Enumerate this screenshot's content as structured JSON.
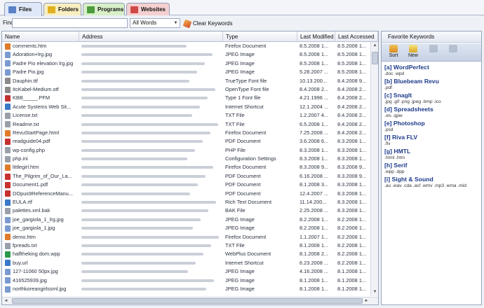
{
  "tabs": [
    {
      "label": "Files",
      "color": "#5b82c6"
    },
    {
      "label": "Folders",
      "color": "#e0b020"
    },
    {
      "label": "Programs",
      "color": "#4c9c3c"
    },
    {
      "label": "Websites",
      "color": "#d04848"
    }
  ],
  "find": {
    "label": "Find:",
    "value": "",
    "mode": "All Words",
    "clear_label": "Clear Keywords"
  },
  "columns": [
    "Name",
    "Address",
    "Type",
    "Last Modified",
    "Last Accessed"
  ],
  "files": [
    {
      "name": "comments.htm",
      "type": "Firefox Document",
      "modified": "8.5.2008 1...",
      "accessed": "8.5.2008 1...",
      "icon_color": "#e07a2a"
    },
    {
      "name": "Adoration+lrg.jpg",
      "type": "JPEG Image",
      "modified": "8.5.2008 1...",
      "accessed": "8.5.2008 1...",
      "icon_color": "#7a9ad0"
    },
    {
      "name": "Padre Pio elevation lrg.jpg",
      "type": "JPEG Image",
      "modified": "8.5.2008 1...",
      "accessed": "8.5.2008 1...",
      "icon_color": "#7a9ad0"
    },
    {
      "name": "Padre Pio.jpg",
      "type": "JPEG Image",
      "modified": "5.28.2007 ...",
      "accessed": "8.5.2008 1...",
      "icon_color": "#7a9ad0"
    },
    {
      "name": "Dauphin.ttf",
      "type": "TrueType Font file",
      "modified": "10.13.200...",
      "accessed": "8.4.2008 9...",
      "icon_color": "#8a8a8a"
    },
    {
      "name": "ItcKabel-Medium.otf",
      "type": "OpenType Font file",
      "modified": "8.4.2008 2...",
      "accessed": "8.4.2008 2...",
      "icon_color": "#8a8a8a"
    },
    {
      "name": "KBB_____.PFM",
      "type": "Type 1 Font file",
      "modified": "4.21.1996 ...",
      "accessed": "8.4.2008 2...",
      "icon_color": "#c03030"
    },
    {
      "name": "Acute Systems Web Sit...",
      "type": "Internet Shortcut",
      "modified": "12.1.2004 ...",
      "accessed": "8.4.2008 2...",
      "icon_color": "#3a78c8"
    },
    {
      "name": "License.txt",
      "type": "TXT File",
      "modified": "1.2.2007 4...",
      "accessed": "8.4.2008 2...",
      "icon_color": "#9aa0aa"
    },
    {
      "name": "Readme.txt",
      "type": "TXT File",
      "modified": "6.5.2008 1...",
      "accessed": "8.4.2008 2...",
      "icon_color": "#9aa0aa"
    },
    {
      "name": "RevuStartPage.html",
      "type": "Firefox Document",
      "modified": "7.25.2008 ...",
      "accessed": "8.4.2008 2...",
      "icon_color": "#e07a2a"
    },
    {
      "name": "readguide04.pdf",
      "type": "PDF Document",
      "modified": "3.6.2008 6...",
      "accessed": "8.3.2008 1...",
      "icon_color": "#c83030"
    },
    {
      "name": "wp-config.php",
      "type": "PHP File",
      "modified": "8.3.2008 1...",
      "accessed": "8.3.2008 1...",
      "icon_color": "#9aa0aa"
    },
    {
      "name": "php.ini",
      "type": "Configuration Settings",
      "modified": "8.3.2008 1...",
      "accessed": "8.3.2008 1...",
      "icon_color": "#9aa0aa"
    },
    {
      "name": "littlegirl.htm",
      "type": "Firefox Document",
      "modified": "8.3.2008 9...",
      "accessed": "8.3.2008 9...",
      "icon_color": "#e07a2a"
    },
    {
      "name": "The_Pilgrim_of_Our_La...",
      "type": "PDF Document",
      "modified": "6.16.2008 ...",
      "accessed": "8.3.2008 9...",
      "icon_color": "#c83030"
    },
    {
      "name": "Document1.pdf",
      "type": "PDF Document",
      "modified": "8.1.2008 3...",
      "accessed": "8.3.2008 1...",
      "icon_color": "#c83030"
    },
    {
      "name": "DOpus9ReferenceManu...",
      "type": "PDF Document",
      "modified": "12.4.2007 ...",
      "accessed": "8.3.2008 1...",
      "icon_color": "#c83030"
    },
    {
      "name": "EULA.rtf",
      "type": "Rich Text Document",
      "modified": "11.14.200...",
      "accessed": "8.3.2008 1...",
      "icon_color": "#3a78c8"
    },
    {
      "name": "palettes.xml.bak",
      "type": "BAK File",
      "modified": "2.25.2008 ...",
      "accessed": "8.3.2008 1...",
      "icon_color": "#9aa0aa"
    },
    {
      "name": "joe_gargiola_1_lrg.jpg",
      "type": "JPEG Image",
      "modified": "8.2.2008 1...",
      "accessed": "8.2.2008 1...",
      "icon_color": "#7a9ad0"
    },
    {
      "name": "joe_gargiola_1.jpg",
      "type": "JPEG Image",
      "modified": "8.2.2008 1...",
      "accessed": "8.2.2008 1...",
      "icon_color": "#7a9ad0"
    },
    {
      "name": "demo.htm",
      "type": "Firefox Document",
      "modified": "1.1.2007 1...",
      "accessed": "8.2.2008 1...",
      "icon_color": "#e07a2a"
    },
    {
      "name": "fpreads.txt",
      "type": "TXT File",
      "modified": "8.1.2008 1...",
      "accessed": "8.2.2008 1...",
      "icon_color": "#9aa0aa"
    },
    {
      "name": "halftheking dom.wpp",
      "type": "WebPlus Document",
      "modified": "8.1.2008 2...",
      "accessed": "8.2.2008 1...",
      "icon_color": "#2a9a4a"
    },
    {
      "name": "buy.url",
      "type": "Internet Shortcut",
      "modified": "6.23.2008 ...",
      "accessed": "8.2.2008 1...",
      "icon_color": "#3a78c8"
    },
    {
      "name": "127-11060 50px.jpg",
      "type": "JPEG Image",
      "modified": "4.16.2008 ...",
      "accessed": "8.1.2008 1...",
      "icon_color": "#7a9ad0"
    },
    {
      "name": "416525939.jpg",
      "type": "JPEG Image",
      "modified": "8.1.2008 1...",
      "accessed": "8.1.2008 1...",
      "icon_color": "#7a9ad0"
    },
    {
      "name": "northkoreangirlssml.jpg",
      "type": "JPEG Image",
      "modified": "8.1.2008 1...",
      "accessed": "8.1.2008 1...",
      "icon_color": "#7a9ad0"
    }
  ],
  "keywords_panel": {
    "title": "Favorite Keywords",
    "buttons": [
      "Sort",
      "New",
      "",
      ""
    ],
    "items": [
      {
        "name": "[a] WordPerfect",
        "ext": ".doc .wpd"
      },
      {
        "name": "[b] Bluebeam Revu",
        "ext": ".pdf"
      },
      {
        "name": "[c] SnagIt",
        "ext": ".jpg .gif .png .jpeg .bmp .ico"
      },
      {
        "name": "[d] Spreadsheets",
        "ext": ".xls .qpw"
      },
      {
        "name": "[e] Photoshop",
        "ext": ".psd"
      },
      {
        "name": "[f] Riva FLV",
        "ext": ".flv"
      },
      {
        "name": "[g] HMTL",
        "ext": ".html .htm"
      },
      {
        "name": "[h] Serif",
        "ext": ".wpp .dpp"
      },
      {
        "name": "[i] Sight & Sound",
        "ext": ".au .wav .cda .asf .wmv .mp3 .wma .mid"
      }
    ]
  }
}
